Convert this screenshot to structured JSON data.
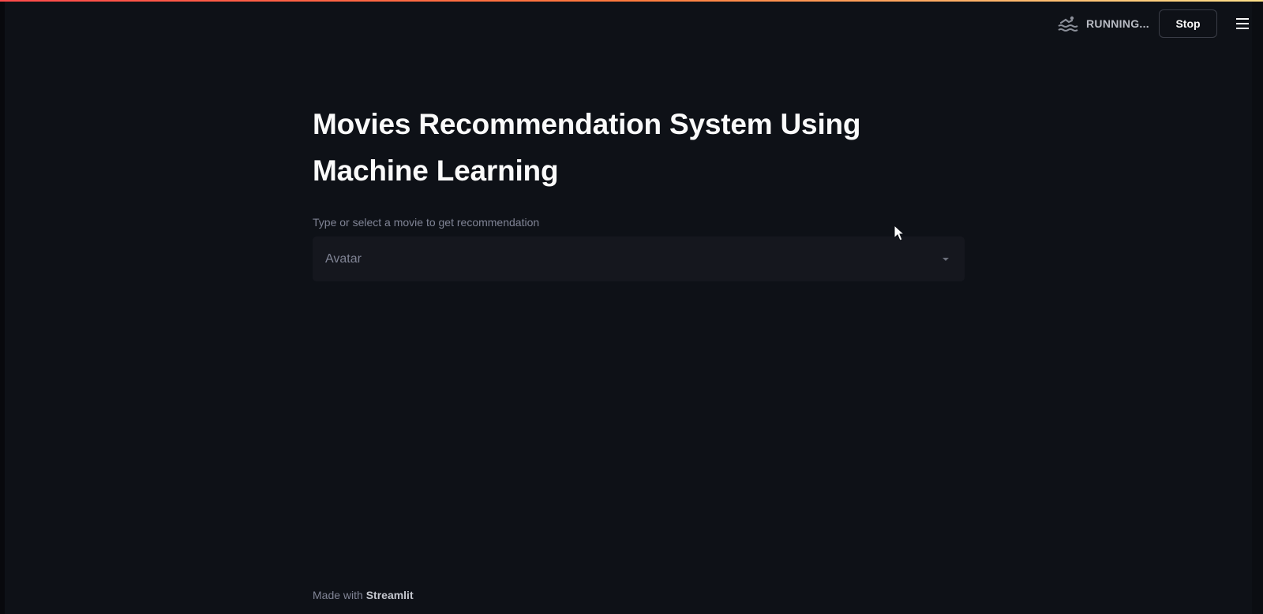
{
  "header": {
    "status_icon": "swimmer-icon",
    "status_label": "RUNNING...",
    "stop_label": "Stop",
    "menu_icon": "menu-icon"
  },
  "main": {
    "title": "Movies Recommendation System Using Machine Learning",
    "select": {
      "label": "Type or select a movie to get recommendation",
      "value": "Avatar",
      "icon": "chevron-down-icon"
    }
  },
  "footer": {
    "prefix": "Made with",
    "link": "Streamlit"
  },
  "colors": {
    "background": "#0e1117",
    "text": "#fafafa",
    "muted": "#808495",
    "select_background": "#15171e",
    "accent_start": "#ff4b4b",
    "accent_end": "#ffe08a"
  }
}
